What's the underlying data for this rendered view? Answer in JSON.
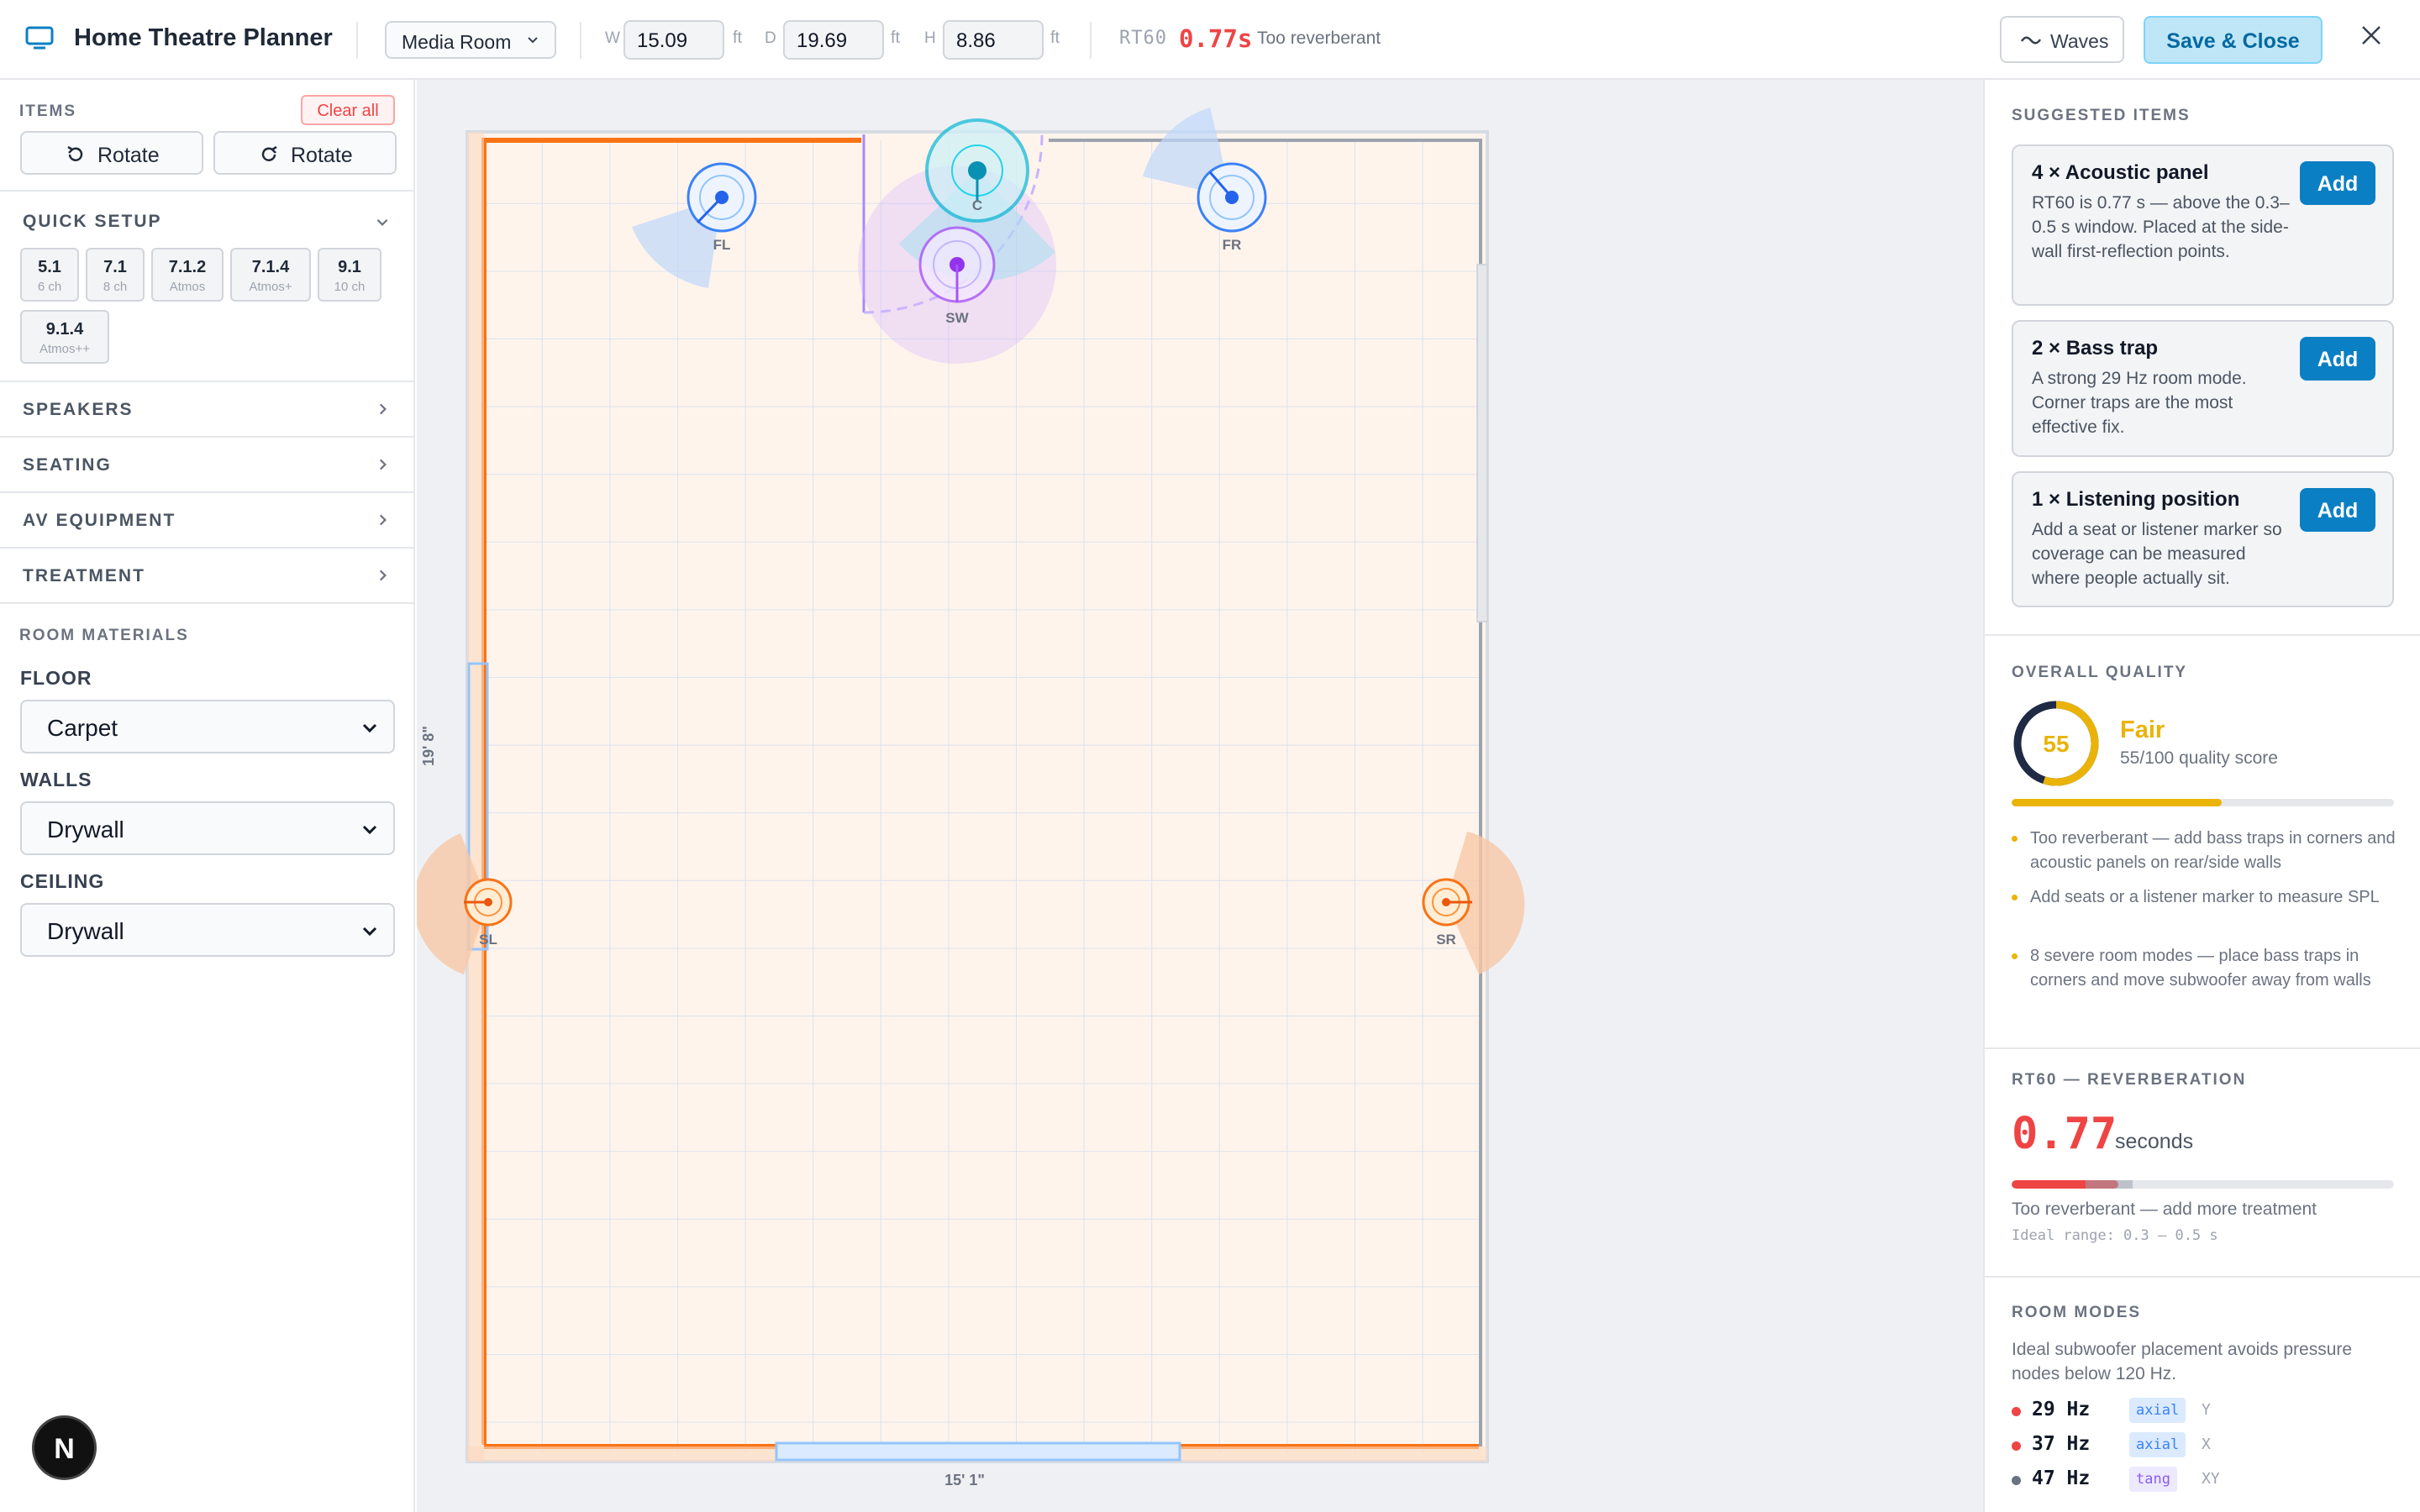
{
  "header": {
    "app_title": "Home Theatre Planner",
    "room_preset": "Media Room",
    "width_label": "W",
    "width_value": "15.09",
    "depth_label": "D",
    "depth_value": "19.69",
    "height_label": "H",
    "height_value": "8.86",
    "unit": "ft",
    "rt60_label": "RT60",
    "rt60_value": "0.77s",
    "rt60_status": "Too reverberant",
    "waves_label": "Waves",
    "save_label": "Save & Close"
  },
  "sidebar": {
    "items_label": "ITEMS",
    "clear_all": "Clear all",
    "rotate_ccw": "Rotate",
    "rotate_cw": "Rotate",
    "quick_setup_label": "QUICK SETUP",
    "quick_setups": [
      {
        "title": "5.1",
        "sub": "6 ch"
      },
      {
        "title": "7.1",
        "sub": "8 ch"
      },
      {
        "title": "7.1.2",
        "sub": "Atmos"
      },
      {
        "title": "7.1.4",
        "sub": "Atmos+"
      },
      {
        "title": "9.1",
        "sub": "10 ch"
      },
      {
        "title": "9.1.4",
        "sub": "Atmos++"
      }
    ],
    "sections": [
      "SPEAKERS",
      "SEATING",
      "AV EQUIPMENT",
      "TREATMENT"
    ],
    "materials_label": "ROOM MATERIALS",
    "floor_label": "FLOOR",
    "floor_value": "Carpet",
    "walls_label": "WALLS",
    "walls_value": "Drywall",
    "ceiling_label": "CEILING",
    "ceiling_value": "Drywall",
    "badge_letter": "N"
  },
  "canvas": {
    "depth_dim": "19' 8\"",
    "width_dim": "15' 1\"",
    "speakers": [
      "FL",
      "C",
      "FR",
      "SW",
      "SL",
      "SR"
    ]
  },
  "right_panel": {
    "suggested_label": "SUGGESTED ITEMS",
    "suggestions": [
      {
        "title": "4 × Acoustic panel",
        "desc": "RT60 is 0.77 s — above the 0.3–0.5 s window. Placed at the side-wall first-reflection points.",
        "action": "Add"
      },
      {
        "title": "2 × Bass trap",
        "desc": "A strong 29 Hz room mode. Corner traps are the most effective fix.",
        "action": "Add"
      },
      {
        "title": "1 × Listening position",
        "desc": "Add a seat or listener marker so coverage can be measured where people actually sit.",
        "action": "Add"
      }
    ],
    "quality_label": "OVERALL QUALITY",
    "quality_score": 55,
    "quality_score_text": "55",
    "quality_rating": "Fair",
    "quality_sub": "55/100 quality score",
    "quality_color": "#eab308",
    "quality_notes": [
      "Too reverberant — add bass traps in corners and acoustic panels on rear/side walls",
      "Add seats or a listener marker to measure SPL",
      "8 severe room modes — place bass traps in corners and move subwoofer away from walls"
    ],
    "rt60_label": "RT60 — REVERBERATION",
    "rt60_value": "0.77",
    "rt60_unit": "seconds",
    "rt60_fraction": 0.28,
    "rt60_status": "Too reverberant — add more treatment",
    "rt60_ideal": "Ideal range: 0.3 – 0.5 s",
    "modes_label": "ROOM MODES",
    "modes_desc": "Ideal subwoofer placement avoids pressure nodes below 120 Hz.",
    "modes": [
      {
        "freq": "29 Hz",
        "type": "axial",
        "axis": "Y",
        "severity": "#ef4444"
      },
      {
        "freq": "37 Hz",
        "type": "axial",
        "axis": "X",
        "severity": "#ef4444"
      },
      {
        "freq": "47 Hz",
        "type": "tang",
        "axis": "XY",
        "severity": "#6b7280"
      }
    ]
  }
}
